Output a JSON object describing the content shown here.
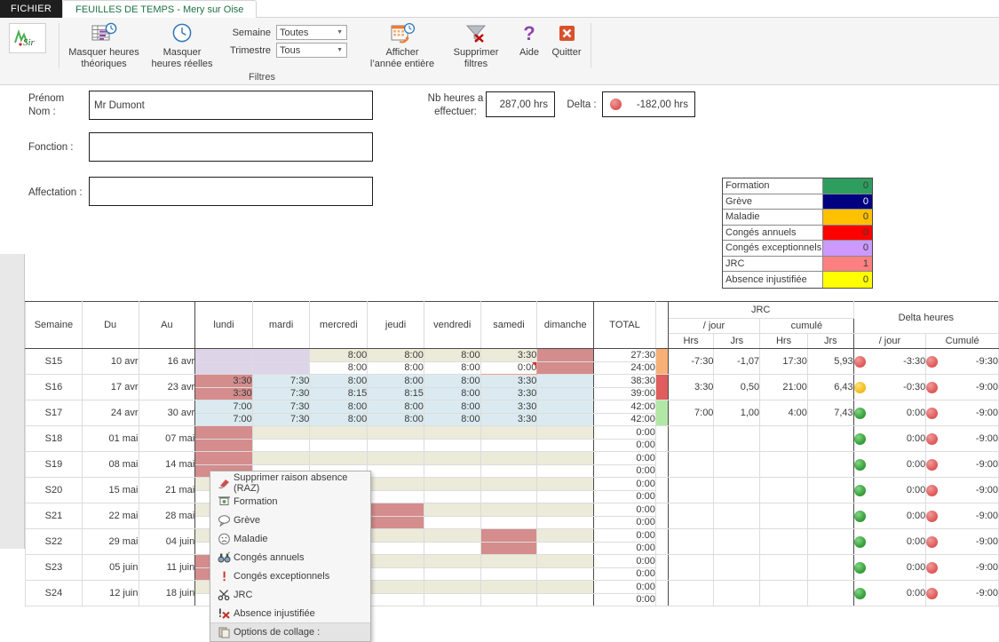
{
  "window": {
    "tab_file": "FICHIER",
    "tab_active": "FEUILLES DE TEMPS - Mery sur Oise"
  },
  "ribbon": {
    "logo_icon": "app-logo-icon",
    "buttons": [
      {
        "label_line1": "Masquer heures",
        "label_line2": "théoriques",
        "icon": "table-clock-icon"
      },
      {
        "label_line1": "Masquer",
        "label_line2": "heures réelles",
        "icon": "clock-icon"
      },
      {
        "label_line1": "Afficher",
        "label_line2": "l’année entière",
        "icon": "calendar-refresh-icon"
      },
      {
        "label_line1": "Supprimer",
        "label_line2": "filtres",
        "icon": "funnel-clear-icon"
      },
      {
        "label_line1": "Aide",
        "label_line2": "",
        "icon": "question-mark-icon"
      },
      {
        "label_line1": "Quitter",
        "label_line2": "",
        "icon": "close-x-icon"
      }
    ],
    "filters": {
      "group_label": "Filtres",
      "semaine_label": "Semaine",
      "semaine_value": "Toutes",
      "trimestre_label": "Trimestre",
      "trimestre_value": "Tous"
    }
  },
  "form": {
    "prenom_label_l1": "Prénom",
    "prenom_label_l2": "Nom :",
    "prenom_value": "Mr Dumont",
    "fonction_label": "Fonction :",
    "fonction_value": "",
    "affectation_label": "Affectation :",
    "affectation_value": "",
    "nb_heures_label_l1": "Nb heures a",
    "nb_heures_label_l2": "effectuer:",
    "nb_heures_value": "287,00 hrs",
    "delta_label": "Delta :",
    "delta_value": "-182,00 hrs",
    "delta_status": "red"
  },
  "legend": {
    "rows": [
      {
        "name": "Formation",
        "count": "0",
        "color": "#2e9e5f"
      },
      {
        "name": "Grève",
        "count": "0",
        "color": "#000080",
        "text_color": "#ffffff"
      },
      {
        "name": "Maladie",
        "count": "0",
        "color": "#ffc000"
      },
      {
        "name": "Congés annuels",
        "count": "0",
        "color": "#ff0000"
      },
      {
        "name": "Congés exceptionnels",
        "count": "0",
        "color": "#cc99ff"
      },
      {
        "name": "JRC",
        "count": "1",
        "color": "#ff8080"
      },
      {
        "name": "Absence injustifiée",
        "count": "0",
        "color": "#ffff00"
      }
    ]
  },
  "table": {
    "headers": {
      "semaine": "Semaine",
      "du": "Du",
      "au": "Au",
      "days": [
        "lundi",
        "mardi",
        "mercredi",
        "jeudi",
        "vendredi",
        "samedi",
        "dimanche"
      ],
      "total": "TOTAL",
      "jrc": "JRC",
      "jrc_par_jour": "/ jour",
      "jrc_cumule": "cumulé",
      "hrs": "Hrs",
      "jrs": "Jrs",
      "delta_heures": "Delta heures",
      "delta_par_jour": "/ jour",
      "delta_cumule": "Cumulé"
    },
    "rows": [
      {
        "semaine": "S15",
        "du": "10 avr",
        "au": "16 avr",
        "theorique": [
          "",
          "",
          "8:00",
          "8:00",
          "8:00",
          "3:30",
          ""
        ],
        "reelle": [
          "",
          "",
          "8:00",
          "8:00",
          "8:00",
          "0:00",
          ""
        ],
        "theo_bg": [
          "purple",
          "purple",
          "cream",
          "cream",
          "cream",
          "cream",
          "rose"
        ],
        "real_bg": [
          "purple",
          "purple",
          "white",
          "white",
          "white",
          "comment",
          "rose"
        ],
        "real_color": [
          "",
          "",
          "green",
          "green",
          "green",
          "orange",
          ""
        ],
        "total_theo": "27:30",
        "total_real": "24:00",
        "swatch": "orange",
        "jrc_jour_hrs": "-7:30",
        "jrc_jour_jrs": "-1,07",
        "jrc_cum_hrs": "17:30",
        "jrc_cum_jrs": "5,93",
        "delta_jour_status": "red",
        "delta_jour": "-3:30",
        "delta_cum_status": "red",
        "delta_cum": "-9:30"
      },
      {
        "semaine": "S16",
        "du": "17 avr",
        "au": "23 avr",
        "theorique": [
          "3:30",
          "7:30",
          "8:00",
          "8:00",
          "8:00",
          "3:30",
          ""
        ],
        "reelle": [
          "3:30",
          "7:30",
          "8:15",
          "8:15",
          "8:00",
          "3:30",
          ""
        ],
        "theo_bg": [
          "rose",
          "blue",
          "blue",
          "blue",
          "blue",
          "blue",
          "blue"
        ],
        "real_bg": [
          "rose",
          "blue",
          "blue",
          "blue",
          "blue",
          "blue",
          "blue"
        ],
        "real_color": [
          "green",
          "green",
          "red",
          "red",
          "green",
          "green",
          ""
        ],
        "total_theo": "38:30",
        "total_real": "39:00",
        "swatch": "red",
        "jrc_jour_hrs": "3:30",
        "jrc_jour_jrs": "0,50",
        "jrc_cum_hrs": "21:00",
        "jrc_cum_jrs": "6,43",
        "delta_jour_status": "amber",
        "delta_jour": "-0:30",
        "delta_cum_status": "red",
        "delta_cum": "-9:00"
      },
      {
        "semaine": "S17",
        "du": "24 avr",
        "au": "30 avr",
        "theorique": [
          "7:00",
          "7:30",
          "8:00",
          "8:00",
          "8:00",
          "3:30",
          ""
        ],
        "reelle": [
          "7:00",
          "7:30",
          "8:00",
          "8:00",
          "8:00",
          "3:30",
          ""
        ],
        "theo_bg": [
          "blue",
          "blue",
          "blue",
          "blue",
          "blue",
          "blue",
          "blue"
        ],
        "real_bg": [
          "blue",
          "blue",
          "blue",
          "blue",
          "blue",
          "blue",
          "blue"
        ],
        "real_color": [
          "green",
          "green",
          "green",
          "green",
          "green",
          "green",
          ""
        ],
        "total_theo": "42:00",
        "total_real": "42:00",
        "swatch": "green",
        "jrc_jour_hrs": "7:00",
        "jrc_jour_jrs": "1,00",
        "jrc_cum_hrs": "4:00",
        "jrc_cum_jrs": "7,43",
        "delta_jour_status": "green",
        "delta_jour": "0:00",
        "delta_cum_status": "red",
        "delta_cum": "-9:00"
      },
      {
        "semaine": "S18",
        "du": "01 mai",
        "au": "07 mai",
        "theorique": [
          "",
          "",
          "",
          "",
          "",
          "",
          ""
        ],
        "reelle": [
          "",
          "",
          "",
          "",
          "",
          "",
          ""
        ],
        "theo_bg": [
          "rose",
          "cream",
          "cream",
          "cream",
          "cream",
          "cream",
          "cream"
        ],
        "real_bg": [
          "rose",
          "white",
          "white",
          "white",
          "white",
          "white",
          "white"
        ],
        "real_color": [
          "",
          "",
          "",
          "",
          "",
          "",
          ""
        ],
        "total_theo": "0:00",
        "total_real": "0:00",
        "swatch": "",
        "jrc_jour_hrs": "",
        "jrc_jour_jrs": "",
        "jrc_cum_hrs": "",
        "jrc_cum_jrs": "",
        "delta_jour_status": "green",
        "delta_jour": "0:00",
        "delta_cum_status": "red",
        "delta_cum": "-9:00"
      },
      {
        "semaine": "S19",
        "du": "08 mai",
        "au": "14 mai",
        "theorique": [
          "",
          "",
          "",
          "",
          "",
          "",
          ""
        ],
        "reelle": [
          "",
          "",
          "",
          "",
          "",
          "",
          ""
        ],
        "theo_bg": [
          "rose",
          "cream",
          "cream",
          "cream",
          "cream",
          "cream",
          "cream"
        ],
        "real_bg": [
          "rose",
          "white",
          "white",
          "white",
          "white",
          "white",
          "white"
        ],
        "real_color": [
          "",
          "",
          "",
          "",
          "",
          "",
          ""
        ],
        "total_theo": "0:00",
        "total_real": "0:00",
        "swatch": "",
        "jrc_jour_hrs": "",
        "jrc_jour_jrs": "",
        "jrc_cum_hrs": "",
        "jrc_cum_jrs": "",
        "delta_jour_status": "green",
        "delta_jour": "0:00",
        "delta_cum_status": "red",
        "delta_cum": "-9:00"
      },
      {
        "semaine": "S20",
        "du": "15 mai",
        "au": "21 mai",
        "theorique": [
          "",
          "",
          "",
          "",
          "",
          "",
          ""
        ],
        "reelle": [
          "",
          "",
          "",
          "",
          "",
          "",
          ""
        ],
        "theo_bg": [
          "cream",
          "cream",
          "cream",
          "cream",
          "cream",
          "cream",
          "cream"
        ],
        "real_bg": [
          "white",
          "white",
          "white",
          "white",
          "white",
          "white",
          "white"
        ],
        "real_color": [
          "",
          "",
          "",
          "",
          "",
          "",
          ""
        ],
        "total_theo": "0:00",
        "total_real": "0:00",
        "swatch": "",
        "jrc_jour_hrs": "",
        "jrc_jour_jrs": "",
        "jrc_cum_hrs": "",
        "jrc_cum_jrs": "",
        "delta_jour_status": "green",
        "delta_jour": "0:00",
        "delta_cum_status": "red",
        "delta_cum": "-9:00"
      },
      {
        "semaine": "S21",
        "du": "22 mai",
        "au": "28 mai",
        "theorique": [
          "",
          "",
          "",
          "",
          "",
          "",
          ""
        ],
        "reelle": [
          "",
          "",
          "",
          "",
          "",
          "",
          ""
        ],
        "theo_bg": [
          "cream",
          "cream",
          "cream",
          "rose",
          "cream",
          "cream",
          "cream"
        ],
        "real_bg": [
          "white",
          "white",
          "white",
          "rose",
          "white",
          "white",
          "white"
        ],
        "real_color": [
          "",
          "",
          "",
          "",
          "",
          "",
          ""
        ],
        "total_theo": "0:00",
        "total_real": "0:00",
        "swatch": "",
        "jrc_jour_hrs": "",
        "jrc_jour_jrs": "",
        "jrc_cum_hrs": "",
        "jrc_cum_jrs": "",
        "delta_jour_status": "green",
        "delta_jour": "0:00",
        "delta_cum_status": "red",
        "delta_cum": "-9:00"
      },
      {
        "semaine": "S22",
        "du": "29 mai",
        "au": "04 juin",
        "theorique": [
          "",
          "",
          "",
          "",
          "",
          "",
          ""
        ],
        "reelle": [
          "",
          "",
          "",
          "",
          "",
          "",
          ""
        ],
        "theo_bg": [
          "cream",
          "cream",
          "cream",
          "cream",
          "cream",
          "rose",
          "cream"
        ],
        "real_bg": [
          "white",
          "white",
          "white",
          "white",
          "white",
          "rose",
          "white"
        ],
        "real_color": [
          "",
          "",
          "",
          "",
          "",
          "",
          ""
        ],
        "total_theo": "0:00",
        "total_real": "0:00",
        "swatch": "",
        "jrc_jour_hrs": "",
        "jrc_jour_jrs": "",
        "jrc_cum_hrs": "",
        "jrc_cum_jrs": "",
        "delta_jour_status": "green",
        "delta_jour": "0:00",
        "delta_cum_status": "red",
        "delta_cum": "-9:00"
      },
      {
        "semaine": "S23",
        "du": "05 juin",
        "au": "11 juin",
        "theorique": [
          "",
          "",
          "",
          "",
          "",
          "",
          ""
        ],
        "reelle": [
          "",
          "",
          "",
          "",
          "",
          "",
          ""
        ],
        "theo_bg": [
          "rose",
          "cream",
          "cream",
          "cream",
          "cream",
          "cream",
          "cream"
        ],
        "real_bg": [
          "rose",
          "white",
          "white",
          "white",
          "white",
          "white",
          "white"
        ],
        "real_color": [
          "",
          "",
          "",
          "",
          "",
          "",
          ""
        ],
        "total_theo": "0:00",
        "total_real": "0:00",
        "swatch": "",
        "jrc_jour_hrs": "",
        "jrc_jour_jrs": "",
        "jrc_cum_hrs": "",
        "jrc_cum_jrs": "",
        "delta_jour_status": "green",
        "delta_jour": "0:00",
        "delta_cum_status": "red",
        "delta_cum": "-9:00"
      },
      {
        "semaine": "S24",
        "du": "12 juin",
        "au": "18 juin",
        "theorique": [
          "",
          "",
          "",
          "",
          "",
          "",
          ""
        ],
        "reelle": [
          "",
          "",
          "",
          "",
          "",
          "",
          ""
        ],
        "theo_bg": [
          "cream",
          "cream",
          "cream",
          "cream",
          "cream",
          "cream",
          "cream"
        ],
        "real_bg": [
          "white",
          "white",
          "white",
          "white",
          "white",
          "white",
          "white"
        ],
        "real_color": [
          "",
          "",
          "",
          "",
          "",
          "",
          ""
        ],
        "total_theo": "0:00",
        "total_real": "0:00",
        "swatch": "",
        "jrc_jour_hrs": "",
        "jrc_jour_jrs": "",
        "jrc_cum_hrs": "",
        "jrc_cum_jrs": "",
        "delta_jour_status": "green",
        "delta_jour": "0:00",
        "delta_cum_status": "red",
        "delta_cum": "-9:00"
      }
    ]
  },
  "context_menu": {
    "items": [
      {
        "label": "Supprimer raison absence (RAZ)",
        "icon": "eraser-icon"
      },
      {
        "label": "Formation",
        "icon": "projector-screen-icon"
      },
      {
        "label": "Grève",
        "icon": "speech-bubble-icon"
      },
      {
        "label": "Maladie",
        "icon": "sad-face-icon"
      },
      {
        "label": "Congés annuels",
        "icon": "binoculars-icon"
      },
      {
        "label": "Congés exceptionnels",
        "icon": "exclamation-icon"
      },
      {
        "label": "JRC",
        "icon": "scissors-icon"
      },
      {
        "label": "Absence injustifiée",
        "icon": "cross-out-icon"
      },
      {
        "label": "Options de collage :",
        "icon": "clipboard-icon"
      }
    ]
  }
}
